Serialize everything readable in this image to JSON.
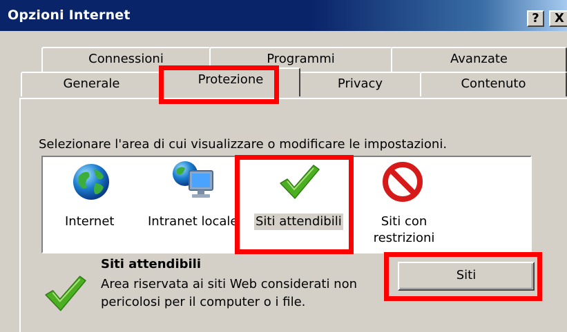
{
  "window": {
    "title": "Opzioni Internet",
    "help_label": "?",
    "close_label": "X"
  },
  "tabs": {
    "row1": [
      "Connessioni",
      "Programmi",
      "Avanzate"
    ],
    "row2": [
      "Generale",
      "Protezione",
      "Privacy",
      "Contenuto"
    ],
    "active": "Protezione"
  },
  "security": {
    "instruction": "Selezionare l'area di cui visualizzare o modificare le impostazioni.",
    "zones": [
      {
        "label": "Internet",
        "icon": "globe-icon"
      },
      {
        "label": "Intranet locale",
        "icon": "intranet-icon"
      },
      {
        "label": "Siti attendibili",
        "icon": "checkmark-icon"
      },
      {
        "label": "Siti con restrizioni",
        "icon": "no-entry-icon"
      }
    ],
    "selected_zone": "Siti attendibili",
    "detail": {
      "title": "Siti attendibili",
      "description": "Area riservata ai siti Web considerati non pericolosi per il computer o i file."
    },
    "sites_button": "Siti"
  },
  "colors": {
    "titlebar": "#0a246a",
    "face": "#d4d0c8",
    "highlight": "#ff0000",
    "check": "#4caf22"
  }
}
